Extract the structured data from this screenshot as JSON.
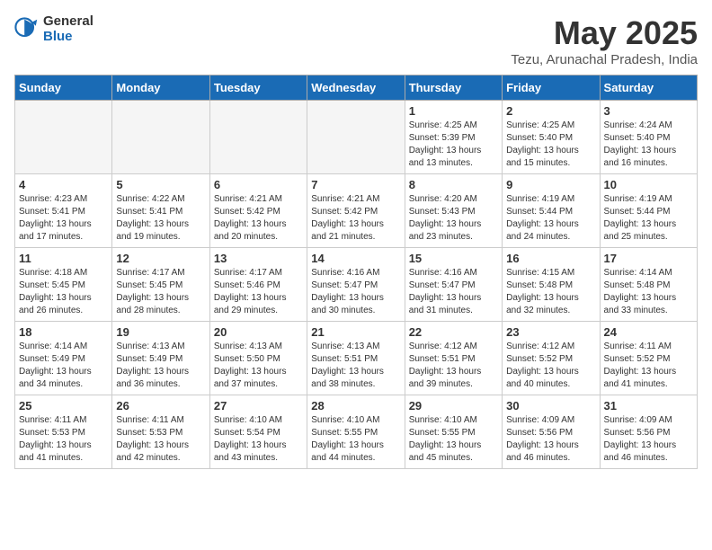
{
  "logo": {
    "general": "General",
    "blue": "Blue"
  },
  "title": "May 2025",
  "subtitle": "Tezu, Arunachal Pradesh, India",
  "days_of_week": [
    "Sunday",
    "Monday",
    "Tuesday",
    "Wednesday",
    "Thursday",
    "Friday",
    "Saturday"
  ],
  "weeks": [
    [
      {
        "num": "",
        "info": ""
      },
      {
        "num": "",
        "info": ""
      },
      {
        "num": "",
        "info": ""
      },
      {
        "num": "",
        "info": ""
      },
      {
        "num": "1",
        "info": "Sunrise: 4:25 AM\nSunset: 5:39 PM\nDaylight: 13 hours\nand 13 minutes."
      },
      {
        "num": "2",
        "info": "Sunrise: 4:25 AM\nSunset: 5:40 PM\nDaylight: 13 hours\nand 15 minutes."
      },
      {
        "num": "3",
        "info": "Sunrise: 4:24 AM\nSunset: 5:40 PM\nDaylight: 13 hours\nand 16 minutes."
      }
    ],
    [
      {
        "num": "4",
        "info": "Sunrise: 4:23 AM\nSunset: 5:41 PM\nDaylight: 13 hours\nand 17 minutes."
      },
      {
        "num": "5",
        "info": "Sunrise: 4:22 AM\nSunset: 5:41 PM\nDaylight: 13 hours\nand 19 minutes."
      },
      {
        "num": "6",
        "info": "Sunrise: 4:21 AM\nSunset: 5:42 PM\nDaylight: 13 hours\nand 20 minutes."
      },
      {
        "num": "7",
        "info": "Sunrise: 4:21 AM\nSunset: 5:42 PM\nDaylight: 13 hours\nand 21 minutes."
      },
      {
        "num": "8",
        "info": "Sunrise: 4:20 AM\nSunset: 5:43 PM\nDaylight: 13 hours\nand 23 minutes."
      },
      {
        "num": "9",
        "info": "Sunrise: 4:19 AM\nSunset: 5:44 PM\nDaylight: 13 hours\nand 24 minutes."
      },
      {
        "num": "10",
        "info": "Sunrise: 4:19 AM\nSunset: 5:44 PM\nDaylight: 13 hours\nand 25 minutes."
      }
    ],
    [
      {
        "num": "11",
        "info": "Sunrise: 4:18 AM\nSunset: 5:45 PM\nDaylight: 13 hours\nand 26 minutes."
      },
      {
        "num": "12",
        "info": "Sunrise: 4:17 AM\nSunset: 5:45 PM\nDaylight: 13 hours\nand 28 minutes."
      },
      {
        "num": "13",
        "info": "Sunrise: 4:17 AM\nSunset: 5:46 PM\nDaylight: 13 hours\nand 29 minutes."
      },
      {
        "num": "14",
        "info": "Sunrise: 4:16 AM\nSunset: 5:47 PM\nDaylight: 13 hours\nand 30 minutes."
      },
      {
        "num": "15",
        "info": "Sunrise: 4:16 AM\nSunset: 5:47 PM\nDaylight: 13 hours\nand 31 minutes."
      },
      {
        "num": "16",
        "info": "Sunrise: 4:15 AM\nSunset: 5:48 PM\nDaylight: 13 hours\nand 32 minutes."
      },
      {
        "num": "17",
        "info": "Sunrise: 4:14 AM\nSunset: 5:48 PM\nDaylight: 13 hours\nand 33 minutes."
      }
    ],
    [
      {
        "num": "18",
        "info": "Sunrise: 4:14 AM\nSunset: 5:49 PM\nDaylight: 13 hours\nand 34 minutes."
      },
      {
        "num": "19",
        "info": "Sunrise: 4:13 AM\nSunset: 5:49 PM\nDaylight: 13 hours\nand 36 minutes."
      },
      {
        "num": "20",
        "info": "Sunrise: 4:13 AM\nSunset: 5:50 PM\nDaylight: 13 hours\nand 37 minutes."
      },
      {
        "num": "21",
        "info": "Sunrise: 4:13 AM\nSunset: 5:51 PM\nDaylight: 13 hours\nand 38 minutes."
      },
      {
        "num": "22",
        "info": "Sunrise: 4:12 AM\nSunset: 5:51 PM\nDaylight: 13 hours\nand 39 minutes."
      },
      {
        "num": "23",
        "info": "Sunrise: 4:12 AM\nSunset: 5:52 PM\nDaylight: 13 hours\nand 40 minutes."
      },
      {
        "num": "24",
        "info": "Sunrise: 4:11 AM\nSunset: 5:52 PM\nDaylight: 13 hours\nand 41 minutes."
      }
    ],
    [
      {
        "num": "25",
        "info": "Sunrise: 4:11 AM\nSunset: 5:53 PM\nDaylight: 13 hours\nand 41 minutes."
      },
      {
        "num": "26",
        "info": "Sunrise: 4:11 AM\nSunset: 5:53 PM\nDaylight: 13 hours\nand 42 minutes."
      },
      {
        "num": "27",
        "info": "Sunrise: 4:10 AM\nSunset: 5:54 PM\nDaylight: 13 hours\nand 43 minutes."
      },
      {
        "num": "28",
        "info": "Sunrise: 4:10 AM\nSunset: 5:55 PM\nDaylight: 13 hours\nand 44 minutes."
      },
      {
        "num": "29",
        "info": "Sunrise: 4:10 AM\nSunset: 5:55 PM\nDaylight: 13 hours\nand 45 minutes."
      },
      {
        "num": "30",
        "info": "Sunrise: 4:09 AM\nSunset: 5:56 PM\nDaylight: 13 hours\nand 46 minutes."
      },
      {
        "num": "31",
        "info": "Sunrise: 4:09 AM\nSunset: 5:56 PM\nDaylight: 13 hours\nand 46 minutes."
      }
    ]
  ]
}
